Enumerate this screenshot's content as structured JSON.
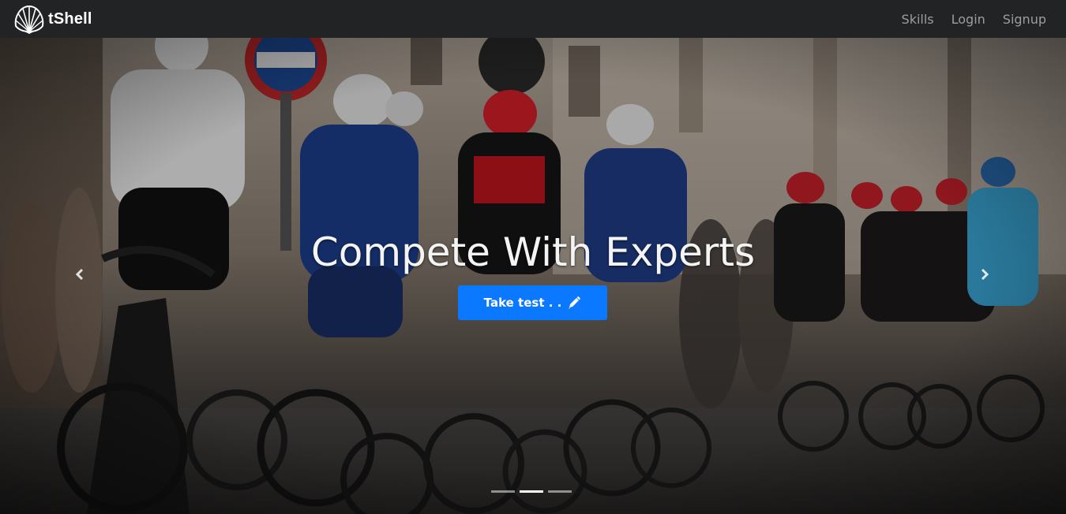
{
  "navbar": {
    "brand": "tShell",
    "links": [
      {
        "label": "Skills"
      },
      {
        "label": "Login"
      },
      {
        "label": "Signup"
      }
    ]
  },
  "hero": {
    "headline": "Compete With Experts",
    "cta_label": "Take test . .",
    "cta_icon": "pencil-icon",
    "cta_color": "#0a79ff",
    "background": "photo of a road cycling peloton",
    "slides": 3,
    "active_slide": 2
  },
  "controls": {
    "prev_icon": "chevron-left-icon",
    "next_icon": "chevron-right-icon"
  }
}
